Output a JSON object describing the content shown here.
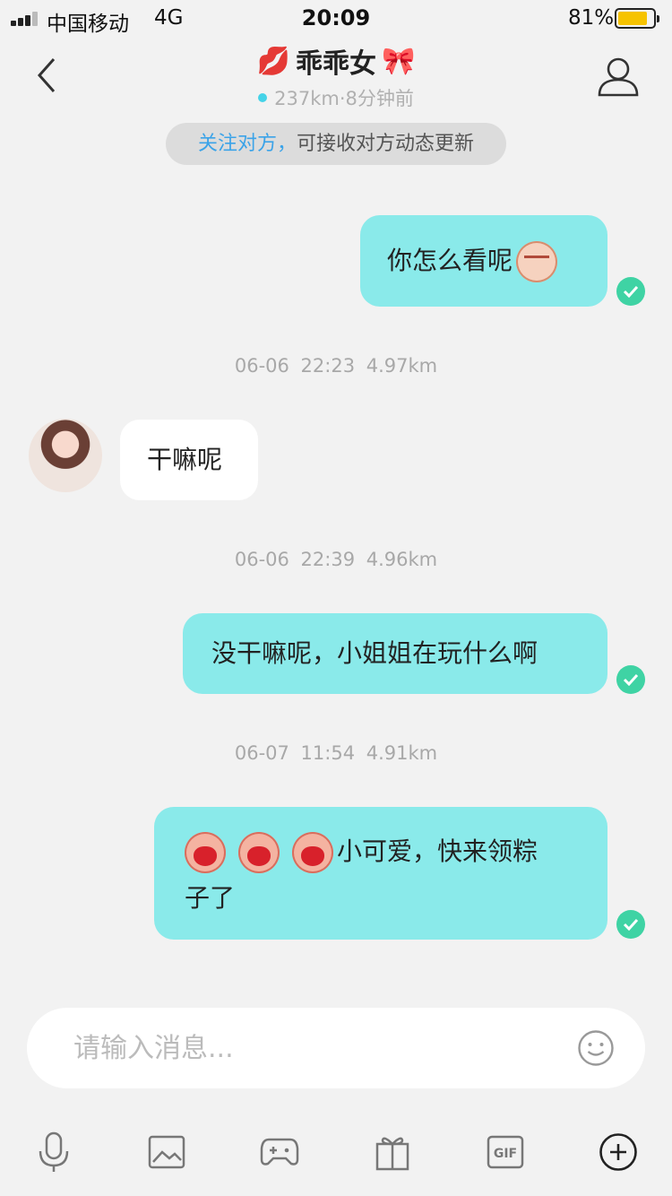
{
  "status_bar": {
    "carrier": "中国移动",
    "network": "4G",
    "time": "20:09",
    "battery_percent": "81%",
    "battery_level": 0.81
  },
  "header": {
    "title_prefix_emoji": "💋",
    "title": "乖乖女",
    "title_suffix_emoji": "🎀",
    "subtitle": "237km·8分钟前"
  },
  "follow_tip": {
    "highlight": "关注对方，",
    "text": "可接收对方动态更新"
  },
  "messages": [
    {
      "from": "me",
      "text": "你怎么看呢",
      "emoji": "sly-face-icon"
    },
    {
      "meta_time": "06-06 22:23",
      "meta_distance": "4.97km"
    },
    {
      "from": "other",
      "text": "干嘛呢"
    },
    {
      "meta_time": "06-06 22:39",
      "meta_distance": "4.96km"
    },
    {
      "from": "me",
      "text": "没干嘛呢，小姐姐在玩什么啊"
    },
    {
      "meta_time": "06-07 11:54",
      "meta_distance": "4.91km"
    },
    {
      "from": "me",
      "text_line1": "小可爱，快来领粽",
      "text_line2": "子了",
      "emoji": "shouting-face-icon",
      "emoji_count": 3
    }
  ],
  "input": {
    "placeholder": "请输入消息..."
  },
  "toolbar": {
    "icons": [
      "microphone-icon",
      "image-icon",
      "gamepad-icon",
      "gift-icon",
      "gif-icon",
      "plus-icon"
    ],
    "gif_label": "GIF"
  },
  "colors": {
    "my_bubble": "#8aeaea",
    "other_bubble": "#ffffff",
    "read_check": "#3fd3a4",
    "online_dot": "#45d3e8",
    "follow_highlight": "#3ba3e8",
    "battery": "#f6c300"
  }
}
